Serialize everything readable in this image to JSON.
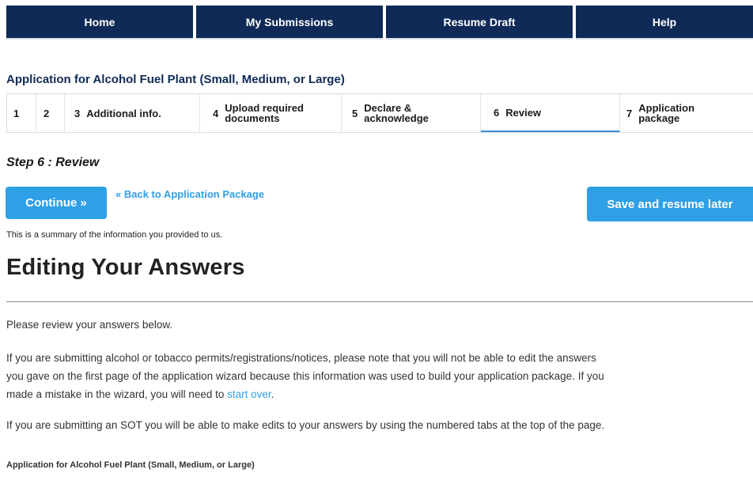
{
  "nav": {
    "items": [
      {
        "label": "Home"
      },
      {
        "label": "My Submissions"
      },
      {
        "label": "Resume Draft"
      },
      {
        "label": "Help"
      }
    ]
  },
  "app_title": "Application for Alcohol Fuel Plant (Small, Medium, or Large)",
  "steps": [
    {
      "num": "1",
      "label": ""
    },
    {
      "num": "2",
      "label": ""
    },
    {
      "num": "3",
      "label": "Additional info."
    },
    {
      "num": "4",
      "label": "Upload required documents"
    },
    {
      "num": "5",
      "label": "Declare & acknowledge"
    },
    {
      "num": "6",
      "label": "Review",
      "active": true
    },
    {
      "num": "7",
      "label": "Application package"
    }
  ],
  "step_heading": "Step 6 : Review",
  "buttons": {
    "continue_label": "Continue »",
    "back_link": "« Back to Application Package",
    "save_label": "Save and resume later"
  },
  "summary_note": "This is a summary of the information you provided to us.",
  "editing_heading": "Editing Your Answers",
  "paragraphs": {
    "review": "Please review your answers below.",
    "alcohol_line1": "If you are submitting alcohol or tobacco permits/registrations/notices, please note that you will not be able to edit the answers",
    "alcohol_line2": "you gave on the first page of the application wizard because this information was used to build your application package. If you",
    "alcohol_line3": "made a mistake in the wizard, you will need to ",
    "start_over_link": "start over",
    "alcohol_line3_end": ".",
    "sot": "If you are submitting an SOT you will be able to make edits to your answers by using the numbered tabs at the top of the page."
  },
  "bottom_title": "Application for Alcohol Fuel Plant (Small, Medium, or Large)",
  "colors": {
    "nav_bg": "#0f2a57",
    "accent": "#2fa0e6",
    "title": "#0f2a57"
  }
}
